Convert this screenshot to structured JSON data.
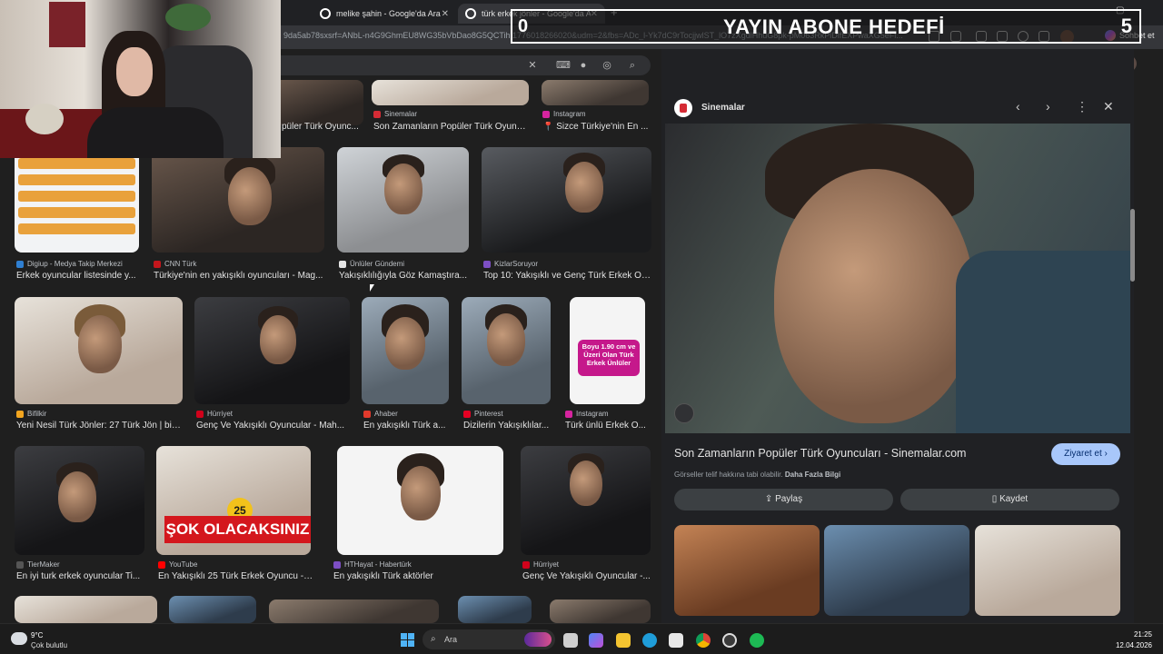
{
  "browser": {
    "tabs": [
      {
        "title": "melike şahin - Google'da Ara"
      },
      {
        "title": "türk erkek jönler - Google'da Ara"
      }
    ],
    "url": "9da5ab78sxsrf=ANbL-n4G9GhmEU8WG35bVbDao8G5QCTih:1776018266020&udm=2&fbs=ADc_l-Yk7dC9rTocjjwlST_lO7zXgdlHhuG8pk-pM063RkPlDlfEXPwaXG5eFl...",
    "copilot_label": "Sohbet et"
  },
  "overlay": {
    "goal_title": "YAYIN ABONE HEDEFİ",
    "goal_current": "0",
    "goal_target": "5"
  },
  "results": [
    {
      "source": "Sinemalar",
      "caption": "Son Zamanların Popüler Türk Oyunc..."
    },
    {
      "source": "Instagram",
      "caption": "📍 Sizce Türkiye'nin En ..."
    },
    {
      "source": "",
      "caption": "püler Türk Oyunc..."
    },
    {
      "source": "Digiup - Medya Takip Merkezi",
      "caption": "Erkek oyuncular listesinde y..."
    },
    {
      "source": "CNN Türk",
      "caption": "Türkiye'nin en yakışıklı oyuncuları - Mag..."
    },
    {
      "source": "Ünlüler Gündemi",
      "caption": "Yakışıklılığıyla Göz Kamaştıra..."
    },
    {
      "source": "KizlarSoruyor",
      "caption": "Top 10: Yakışıklı ve Genç Türk Erkek Oy..."
    },
    {
      "source": "Bifilkir",
      "caption": "Yeni Nesil Türk Jönler: 27 Türk Jön | bifi..."
    },
    {
      "source": "Hürriyet",
      "caption": "Genç Ve Yakışıklı Oyuncular - Mah..."
    },
    {
      "source": "Ahaber",
      "caption": "En yakışıklı Türk a..."
    },
    {
      "source": "Pinterest",
      "caption": "Dizilerin Yakışıklılar..."
    },
    {
      "source": "Instagram",
      "caption": "Türk ünlü Erkek O..."
    },
    {
      "source": "TierMaker",
      "caption": "En iyi turk erkek oyuncular Ti..."
    },
    {
      "source": "YouTube",
      "caption": "En Yakışıklı 25 Türk Erkek Oyuncu -E..."
    },
    {
      "source": "HTHayat - Habertürk",
      "caption": "En yakışıklı Türk aktörler"
    },
    {
      "source": "Hürriyet",
      "caption": "Genç Ve Yakışıklı Oyuncular -..."
    }
  ],
  "image_text": {
    "sok": "ŞOK OLACAKSINIZ",
    "badge25": "25",
    "pink": "Boyu 1.90 cm ve Üzeri Olan Türk Erkek Ünlüler"
  },
  "panel": {
    "site": "Sinemalar",
    "title": "Son Zamanların Popüler Türk Oyuncuları - Sinemalar.com",
    "visit": "Ziyaret et",
    "copyright": "Görseller telif hakkına tabi olabilir.",
    "more_info": "Daha Fazla Bilgi",
    "share": "Paylaş",
    "save": "Kaydet"
  },
  "taskbar": {
    "temp": "9°C",
    "weather": "Çok bulutlu",
    "search": "Ara",
    "time": "21:25",
    "date": "12.04.2026"
  },
  "colors": {
    "accent": "#a8c7fa",
    "sok_red": "#d4171d",
    "pink": "#c5188b"
  }
}
